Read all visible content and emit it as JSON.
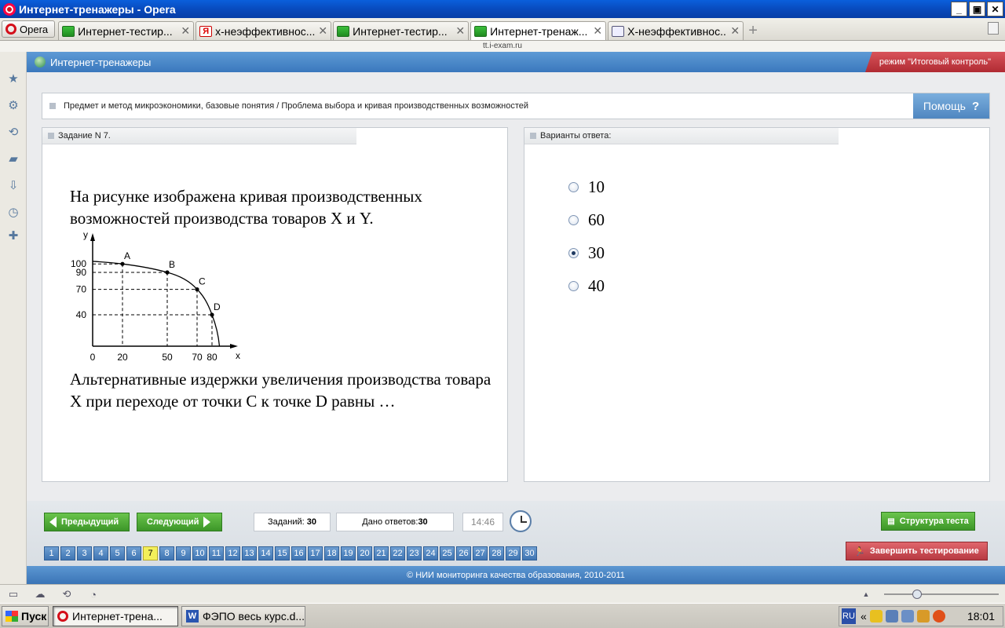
{
  "window": {
    "title": "Интернет-тренажеры - Opera",
    "min": "_",
    "restore": "▣",
    "close": "✕"
  },
  "browser": {
    "menu_label": "Opera",
    "tabs": [
      {
        "label": "Интернет-тестир...",
        "icon": "green-site-icon"
      },
      {
        "label": "x-неэффективнос...",
        "icon": "yandex-icon"
      },
      {
        "label": "Интернет-тестир...",
        "icon": "green-site-icon"
      },
      {
        "label": "Интернет-тренаж...",
        "icon": "green-site-icon",
        "active": true
      },
      {
        "label": "X-неэффективнос...",
        "icon": "document-icon"
      }
    ],
    "tab_close": "✕",
    "new_tab": "+",
    "address": "tt.i-exam.ru"
  },
  "app": {
    "title": "Интернет-тренажеры",
    "mode": "режим \"Итоговый контроль\"",
    "topic": "Предмет и метод микроэкономики, базовые понятия / Проблема выбора и кривая производственных возможностей",
    "help_label": "Помощь",
    "help_icon": "?"
  },
  "task": {
    "header": "Задание N 7.",
    "intro": "На рисунке изображена кривая производственных возможностей производства товаров X и Y.",
    "question": "Альтернативные издержки увеличения производства товара X при переходе от точки C к точке D равны …"
  },
  "chart_data": {
    "type": "line",
    "xlabel": "x",
    "ylabel": "y",
    "x_ticks": [
      "0",
      "20",
      "50",
      "70",
      "80"
    ],
    "y_ticks": [
      "100",
      "90",
      "70",
      "40"
    ],
    "points": [
      {
        "name": "A",
        "x": 20,
        "y": 100
      },
      {
        "name": "B",
        "x": 50,
        "y": 90
      },
      {
        "name": "C",
        "x": 70,
        "y": 70
      },
      {
        "name": "D",
        "x": 80,
        "y": 40
      }
    ],
    "dashed_guides": true
  },
  "answers": {
    "header": "Варианты ответа:",
    "options": [
      {
        "label": "10",
        "selected": false
      },
      {
        "label": "60",
        "selected": false
      },
      {
        "label": "30",
        "selected": true
      },
      {
        "label": "40",
        "selected": false
      }
    ]
  },
  "nav": {
    "prev_label": "Предыдущий",
    "next_label": "Следующий",
    "tasks_label": "Заданий:",
    "tasks_value": "30",
    "answered_label": "Дано ответов:",
    "answered_value": "30",
    "timer": "14:46",
    "structure_label": "Структура теста",
    "finish_label": "Завершить тестирование",
    "current_page": 7,
    "pages": [
      "1",
      "2",
      "3",
      "4",
      "5",
      "6",
      "7",
      "8",
      "9",
      "10",
      "11",
      "12",
      "13",
      "14",
      "15",
      "16",
      "17",
      "18",
      "19",
      "20",
      "21",
      "22",
      "23",
      "24",
      "25",
      "26",
      "27",
      "28",
      "29",
      "30"
    ]
  },
  "footer": "© НИИ мониторинга качества образования, 2010-2011",
  "taskbar": {
    "start_label": "Пуск",
    "items": [
      {
        "label": "Интернет-трена...",
        "active": true
      },
      {
        "label": "ФЭПО весь курс.d...",
        "active": false
      }
    ],
    "lang": "RU",
    "tray_arrows": "«",
    "clock": "18:01"
  },
  "colors": {
    "header_blue": "#4a88c9",
    "mode_red": "#c43d45",
    "nav_green": "#4fae35",
    "current_page_yellow": "#f3ef5a"
  }
}
